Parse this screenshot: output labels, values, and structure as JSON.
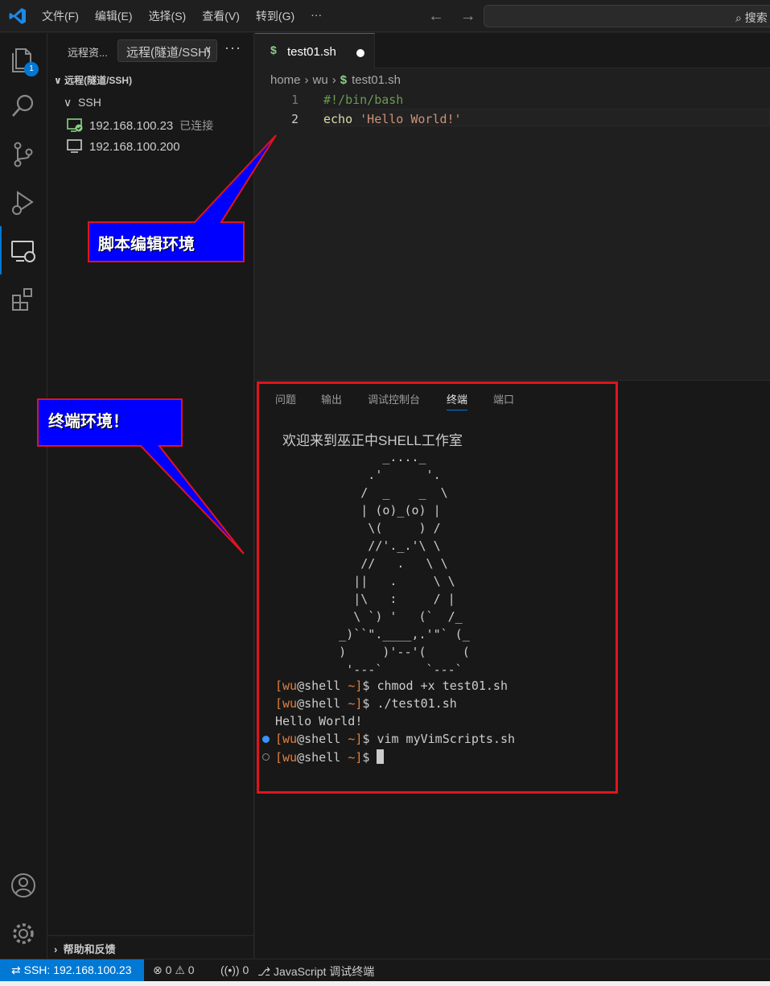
{
  "titlebar": {
    "menu": [
      "文件(F)",
      "编辑(E)",
      "选择(S)",
      "查看(V)",
      "转到(G)",
      "···"
    ],
    "search_text": "搜索"
  },
  "activity": {
    "explorer_badge": "1"
  },
  "sidebar": {
    "header": "远程资...",
    "select_value": "远程(隧道/SSH)",
    "section": "远程(隧道/SSH)",
    "ssh_group": "SSH",
    "hosts": [
      {
        "ip": "192.168.100.23",
        "status": "已连接"
      },
      {
        "ip": "192.168.100.200",
        "status": ""
      }
    ],
    "help": "帮助和反馈"
  },
  "editor": {
    "tab": {
      "name": "test01.sh"
    },
    "breadcrumb": [
      "home",
      "wu",
      "test01.sh"
    ],
    "lines": [
      {
        "num": "1",
        "text": "#!/bin/bash"
      },
      {
        "num": "2",
        "cmd": "echo",
        "arg": "'Hello World!'"
      }
    ]
  },
  "panel": {
    "tabs": [
      "问题",
      "输出",
      "调试控制台",
      "终端",
      "端口"
    ],
    "active_tab": "终端",
    "welcome": "欢迎来到巫正中SHELL工作室",
    "ascii_art": "            _...._\n          .'      '.\n         /  _    _  \\\n         | (o)_(o) |\n          \\(     ) /\n          //'._.'\\ \\\n         //   .   \\ \\\n        ||   .     \\ \\\n        |\\   :     / |\n        \\ `) '   (`  /_\n      _)``\".____,.'\"` (_\n      )     )'--'(     (\n       '---`      `---`",
    "prompt": {
      "user": "wu",
      "host": "shell",
      "path": "~"
    },
    "commands": [
      "chmod +x test01.sh",
      "./test01.sh",
      "vim myVimScripts.sh",
      ""
    ],
    "output": "Hello World!"
  },
  "callouts": {
    "script_env": "脚本编辑环境",
    "terminal_env": "终端环境！"
  },
  "statusbar": {
    "remote": "SSH: 192.168.100.23",
    "errors": "0",
    "warnings": "0",
    "ports": "0",
    "debug_terminal": "JavaScript 调试终端"
  },
  "colors": {
    "accent": "#0078d4",
    "callout_fill": "#0000ff",
    "callout_border": "#e0141e",
    "frame": "#e0141e",
    "prompt": "#e08040"
  }
}
